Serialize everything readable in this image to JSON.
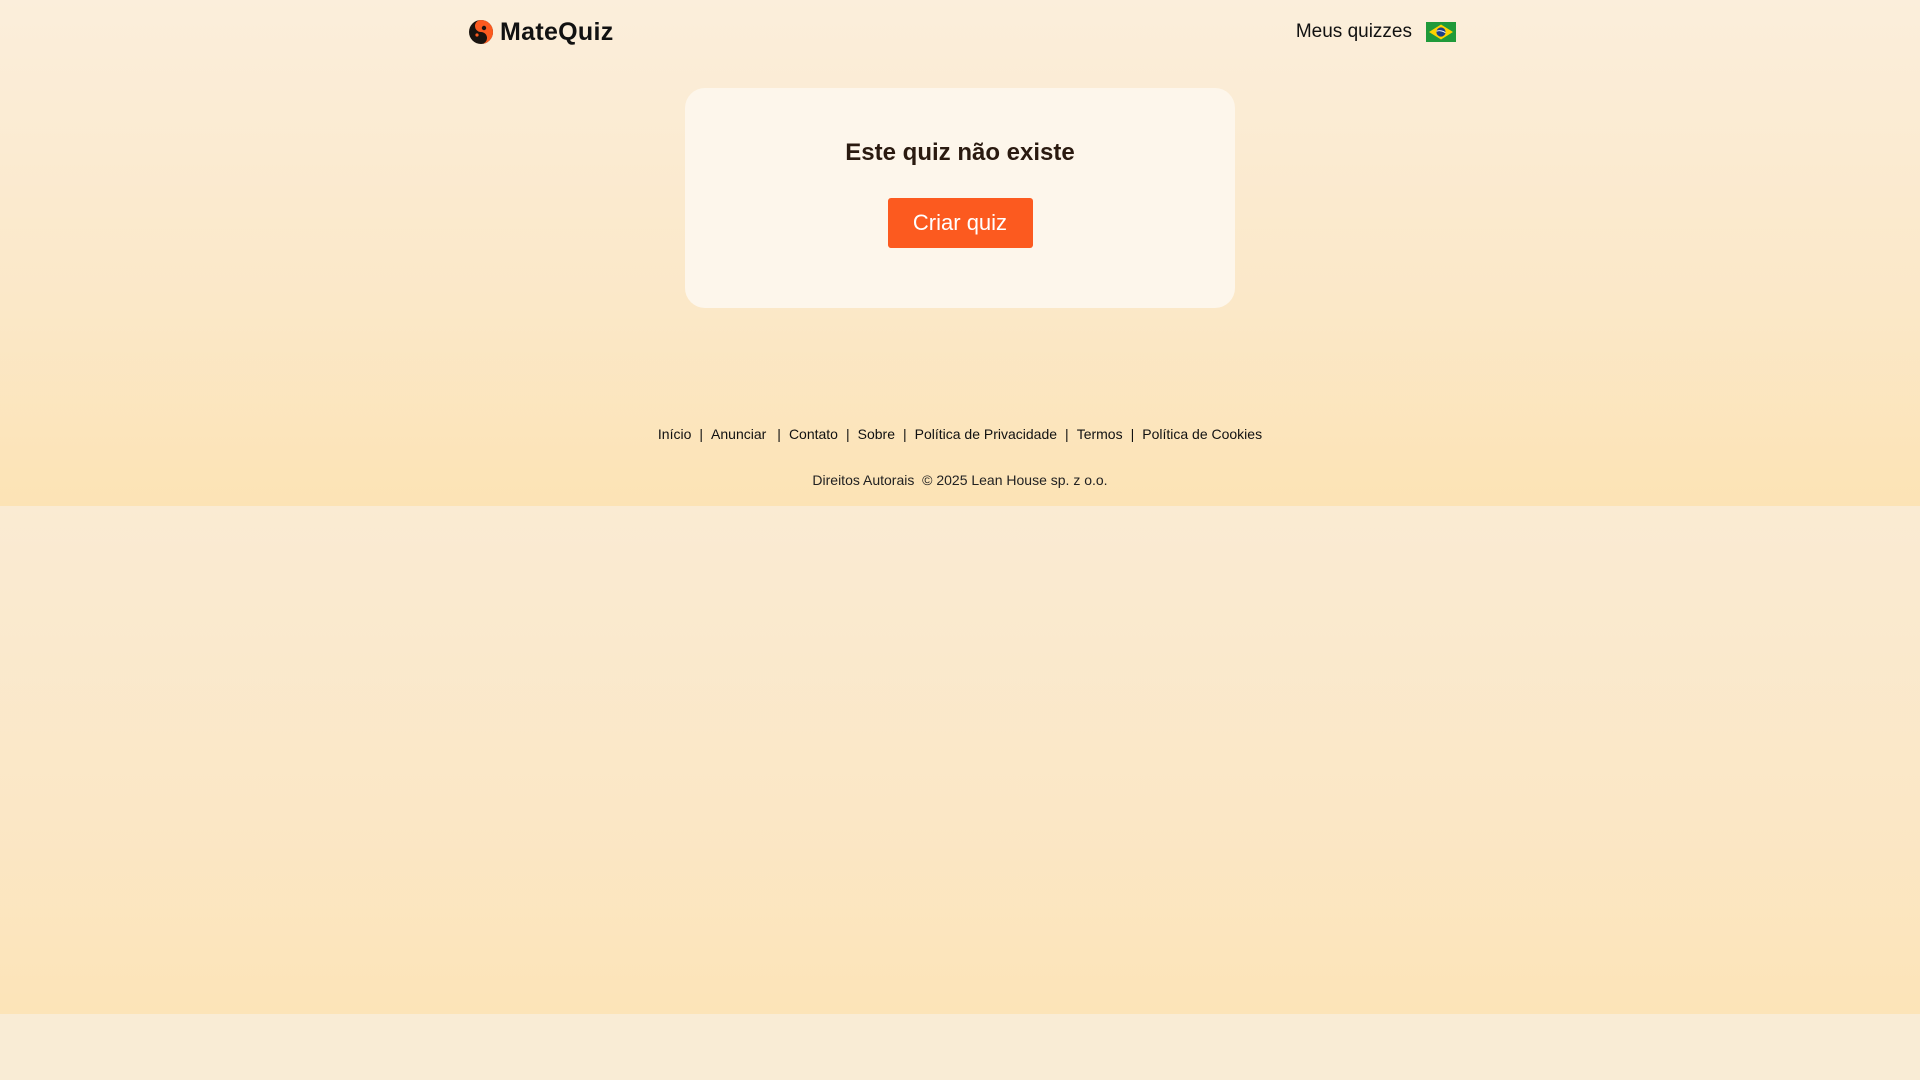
{
  "header": {
    "logo_text": "MateQuiz",
    "my_quizzes": "Meus quizzes",
    "language_flag": "brazil-flag"
  },
  "card": {
    "title": "Este quiz não existe",
    "button_label": "Criar quiz"
  },
  "footer": {
    "links": [
      "Início",
      "Anunciar",
      "Contato",
      "Sobre",
      "Política de Privacidade",
      "Termos",
      "Política de Cookies"
    ],
    "copyright_label": "Direitos Autorais",
    "copyright_text": "© 2025 Lean House sp. z o.o."
  },
  "colors": {
    "accent": "#fc5a1f",
    "background": "#fbeedb",
    "card": "#fdf6eb"
  }
}
